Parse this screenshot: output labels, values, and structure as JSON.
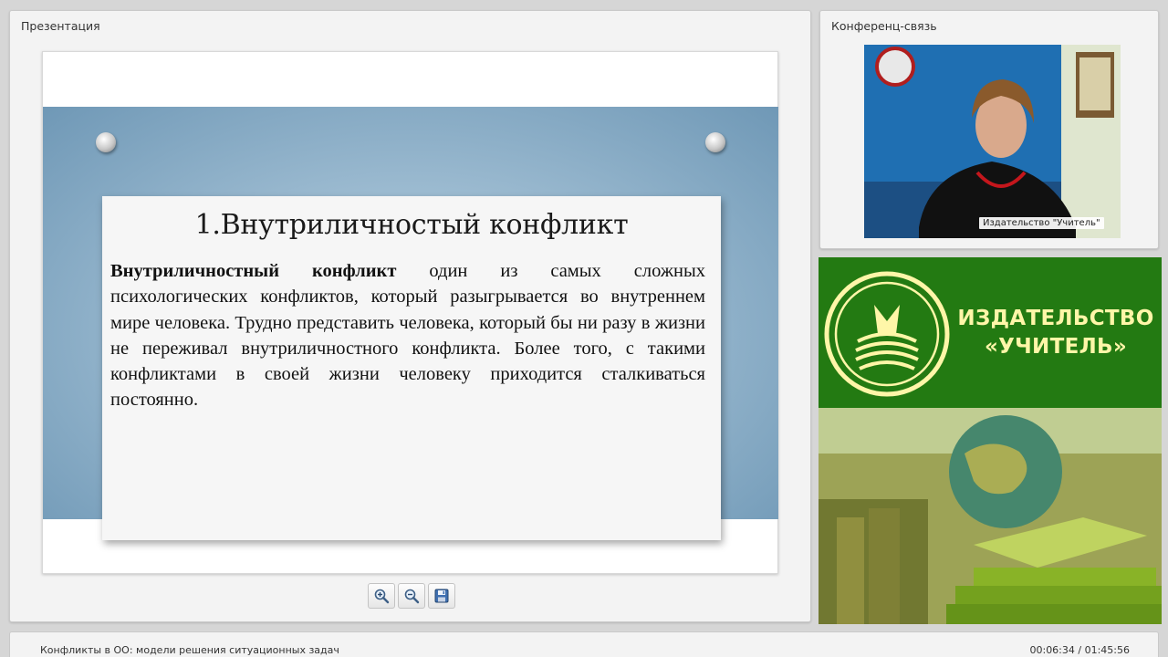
{
  "presentation": {
    "panel_title": "Презентация",
    "slide": {
      "heading": "1.Внутриличностый конфликт",
      "term": "Внутриличностный конфликт",
      "text": " один из самых сложных психологических конфликтов, который разыгрывается во внутреннем мире человека. Трудно представить человека, который бы ни разу в жизни не переживал внутриличностного конфликта. Более того, с такими конфликтами в своей жизни человеку приходится сталкиваться постоянно."
    },
    "toolbar": {
      "zoom_in_icon": "zoom-in-icon",
      "zoom_out_icon": "zoom-out-icon",
      "save_icon": "save-icon"
    }
  },
  "conference": {
    "panel_title": "Конференц-связь",
    "video_caption": "Издательство \"Учитель\""
  },
  "brand": {
    "name_line1": "ИЗДАТЕЛЬСТВО",
    "name_line2": "«УЧИТЕЛЬ»",
    "colors": {
      "green": "#237a12",
      "text": "#fff6a8"
    }
  },
  "footer": {
    "course_title": "Конфликты в ОО: модели решения ситуационных задач",
    "time": "00:06:34 / 01:45:56"
  }
}
